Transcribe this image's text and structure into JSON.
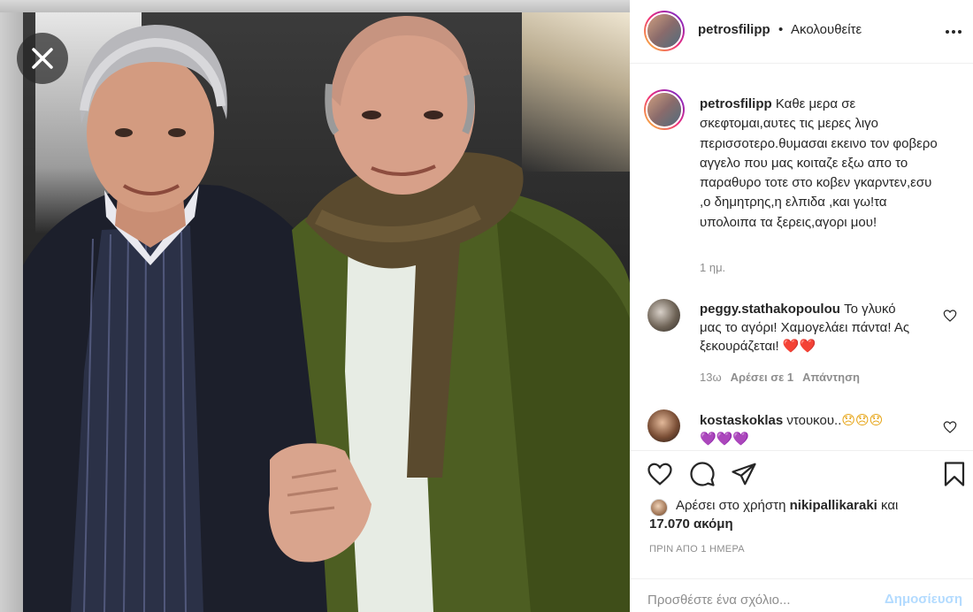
{
  "header": {
    "username": "petrosfilipp",
    "separator": "•",
    "follow_status": "Ακολουθείτε"
  },
  "caption": {
    "username": "petrosfilipp",
    "text": "Καθε μερα σε σκεφτομαι,αυτες τις μερες λιγο περισσοτερο.θυμασαι εκεινο τον φοβερο αγγελο που μας κοιταζε εξω απο το παραθυρο τοτε στο κοβεν γκαρντεν,εσυ ,ο δημητρης,η ελπιδα ,και γω!τα υπολοιπα τα ξερεις,αγορι μου!",
    "time": "1 ημ."
  },
  "comments": [
    {
      "username": "peggy.stathakopoulou",
      "text": "Το γλυκό μας το αγόρι! Χαμογελάει πάντα! Ας ξεκουράζεται!",
      "emoji": "❤️❤️",
      "time": "13ω",
      "likes": "Αρέσει σε 1",
      "reply": "Απάντηση"
    },
    {
      "username": "kostaskoklas",
      "text": "ντουκου..",
      "emoji": "😞😞😞",
      "emoji2": "💜💜💜"
    }
  ],
  "likes": {
    "prefix": "Αρέσει στο χρήστη",
    "user": "nikipallikaraki",
    "conj": "και",
    "count": "17.070 ακόμη"
  },
  "timestamp": "ΠΡΙΝ ΑΠΟ 1 ΗΜΕΡΑ",
  "comment_box": {
    "placeholder": "Προσθέστε ένα σχόλιο...",
    "post_label": "Δημοσίευση"
  },
  "icons": {
    "close": "close-icon",
    "more": "more-options-icon",
    "like": "heart-icon",
    "comment": "comment-icon",
    "share": "send-icon",
    "save": "bookmark-icon"
  },
  "colors": {
    "link_inactive": "#b3dbff",
    "secondary_text": "#8e8e8e",
    "heart_red": "#e0142c"
  }
}
